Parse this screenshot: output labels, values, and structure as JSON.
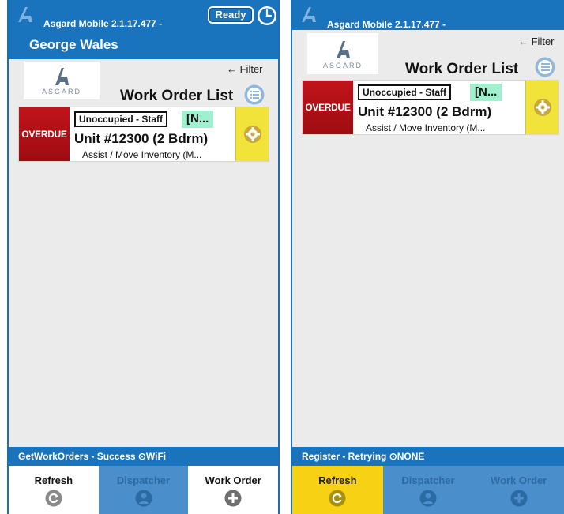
{
  "left_screen": {
    "header": {
      "app_title": "Asgard Mobile 2.1.17.477 -",
      "user_name": "George Wales",
      "ready_label": "Ready"
    },
    "list": {
      "logo_text": "ASGARD",
      "filter_label": "← Filter",
      "title": "Work Order List",
      "work_order": {
        "overdue_label": "OVERDUE",
        "occupancy": "Unoccupied - Staff",
        "status": "[N...",
        "unit": "Unit #12300 (2 Bdrm)",
        "description": "Assist / Move Inventory (M..."
      }
    },
    "status_bar": "GetWorkOrders - Success ⊙WiFi",
    "tabs": [
      {
        "label": "Refresh",
        "icon": "refresh-icon"
      },
      {
        "label": "Dispatcher",
        "icon": "person-icon"
      },
      {
        "label": "Work Order",
        "icon": "plus-icon"
      }
    ]
  },
  "right_screen": {
    "header": {
      "app_title": "Asgard Mobile 2.1.17.477 -"
    },
    "list": {
      "logo_text": "ASGARD",
      "filter_label": "← Filter",
      "title": "Work Order List",
      "work_order": {
        "overdue_label": "OVERDUE",
        "occupancy": "Unoccupied - Staff",
        "status": "[N...",
        "unit": "Unit #12300 (2 Bdrm)",
        "description": "Assist / Move Inventory (M..."
      }
    },
    "status_bar": "Register - Retrying ⊙NONE",
    "tabs": [
      {
        "label": "Refresh",
        "icon": "refresh-icon"
      },
      {
        "label": "Dispatcher",
        "icon": "person-icon"
      },
      {
        "label": "Work Order",
        "icon": "plus-icon"
      }
    ]
  },
  "colors": {
    "header_blue": "#1a73bd",
    "overdue_red": "#b5111a",
    "status_green": "#9ef0cf",
    "action_yellow": "#f2e33a",
    "active_tab_yellow": "#f7d214"
  }
}
